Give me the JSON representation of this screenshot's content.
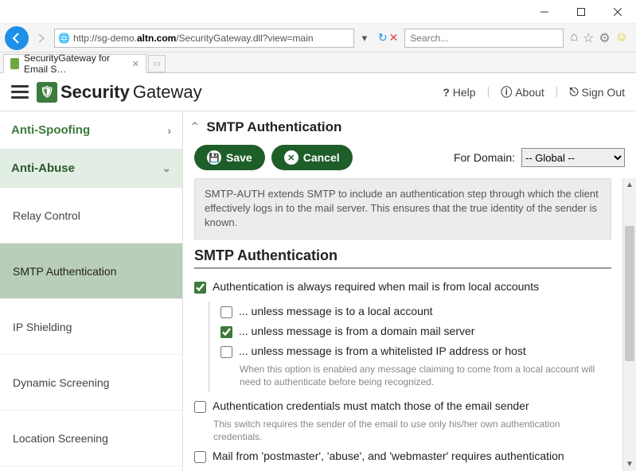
{
  "browser": {
    "url_prefix": "http://sg-demo.",
    "url_bold": "altn.com",
    "url_suffix": "/SecurityGateway.dll?view=main",
    "search_placeholder": "Search...",
    "tab_title": "SecurityGateway for Email S…"
  },
  "header": {
    "logo_part1": "Security",
    "logo_part2": "Gateway",
    "help": "Help",
    "about": "About",
    "signout": "Sign Out"
  },
  "sidebar": {
    "section_top": "Anti-Spoofing",
    "section_active": "Anti-Abuse",
    "items": [
      "Relay Control",
      "SMTP Authentication",
      "IP Shielding",
      "Dynamic Screening",
      "Location Screening"
    ]
  },
  "content": {
    "page_title": "SMTP Authentication",
    "save": "Save",
    "cancel": "Cancel",
    "for_domain_label": "For Domain:",
    "domain_selected": "-- Global --",
    "description": "SMTP-AUTH extends SMTP to include an authentication step through which the client effectively logs in to the mail server. This ensures that the true identity of the sender is known.",
    "section_heading": "SMTP Authentication",
    "opt_auth_required": "Authentication is always required when mail is from local accounts",
    "sub1": "... unless message is to a local account",
    "sub2": "... unless message is from a domain mail server",
    "sub3": "... unless message is from a whitelisted IP address or host",
    "sub3_help": "When this option is enabled any message claiming to come from a local account will need to authenticate before being recognized.",
    "opt_creds_match": "Authentication credentials must match those of the email sender",
    "opt_creds_match_help": "This switch requires the sender of the email to use only his/her own authentication credentials.",
    "opt_postmaster": "Mail from 'postmaster', 'abuse', and 'webmaster' requires authentication"
  }
}
